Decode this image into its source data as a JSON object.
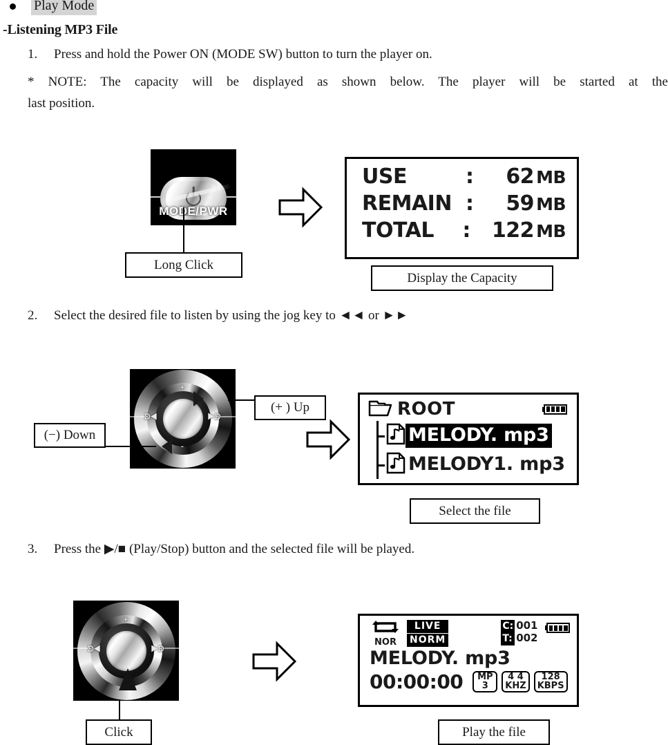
{
  "heading": {
    "bullet_label": "Play Mode",
    "subheading": "-Listening MP3 File"
  },
  "steps": [
    {
      "num": "1.",
      "text": "Press and hold the Power ON (MODE SW) button to turn the player on."
    },
    {
      "num": "2.",
      "text": "Select the desired file to listen by using the jog key to ◄◄ or ►►"
    },
    {
      "num": "3.",
      "text": "Press the ▶/■ (Play/Stop) button and the selected file will be played."
    }
  ],
  "note": {
    "line1": "* NOTE: The capacity will be displayed as shown below. The player will be started at the",
    "line2": "last position."
  },
  "figure1": {
    "device_caption": "MODE/PWR",
    "callout_left": "Long Click",
    "callout_right": "Display the Capacity",
    "arrow": "right-block-arrow",
    "lcd": {
      "rows": [
        {
          "label": "USE",
          "colon": ":",
          "value": "62",
          "unit": "MB"
        },
        {
          "label": "REMAIN",
          "colon": ":",
          "value": "59",
          "unit": "MB"
        },
        {
          "label": "TOTAL",
          "colon": ":",
          "value": "122",
          "unit": "MB"
        }
      ]
    }
  },
  "figure2": {
    "callout_up": "(+ ) Up",
    "callout_down": "(−) Down",
    "callout_bottom": "Select the file",
    "jog_marks": {
      "up": "+",
      "down": "-",
      "prev": "ᗥ◀",
      "next": "▶ᗥ"
    },
    "lcd": {
      "folder": "ROOT",
      "files": [
        {
          "name": "MELODY. mp3",
          "selected": true
        },
        {
          "name": "MELODY1. mp3",
          "selected": false
        }
      ],
      "battery_cells": 4
    }
  },
  "figure3": {
    "callout_click": "Click",
    "callout_bottom": "Play the file",
    "lcd": {
      "repeat_mode": "NOR",
      "eq_line1": "LIVE",
      "eq_line2": "NORM",
      "counter": {
        "current_key": "C:",
        "current_value": "001",
        "total_key": "T:",
        "total_value": "002"
      },
      "battery_cells": 4,
      "title": "MELODY. mp3",
      "time": "00:00:00",
      "badges": [
        {
          "line1": "MP",
          "line2": "3"
        },
        {
          "line1": "4 4",
          "line2": "KHZ"
        },
        {
          "line1": "128",
          "line2": "KBPS"
        }
      ]
    }
  }
}
